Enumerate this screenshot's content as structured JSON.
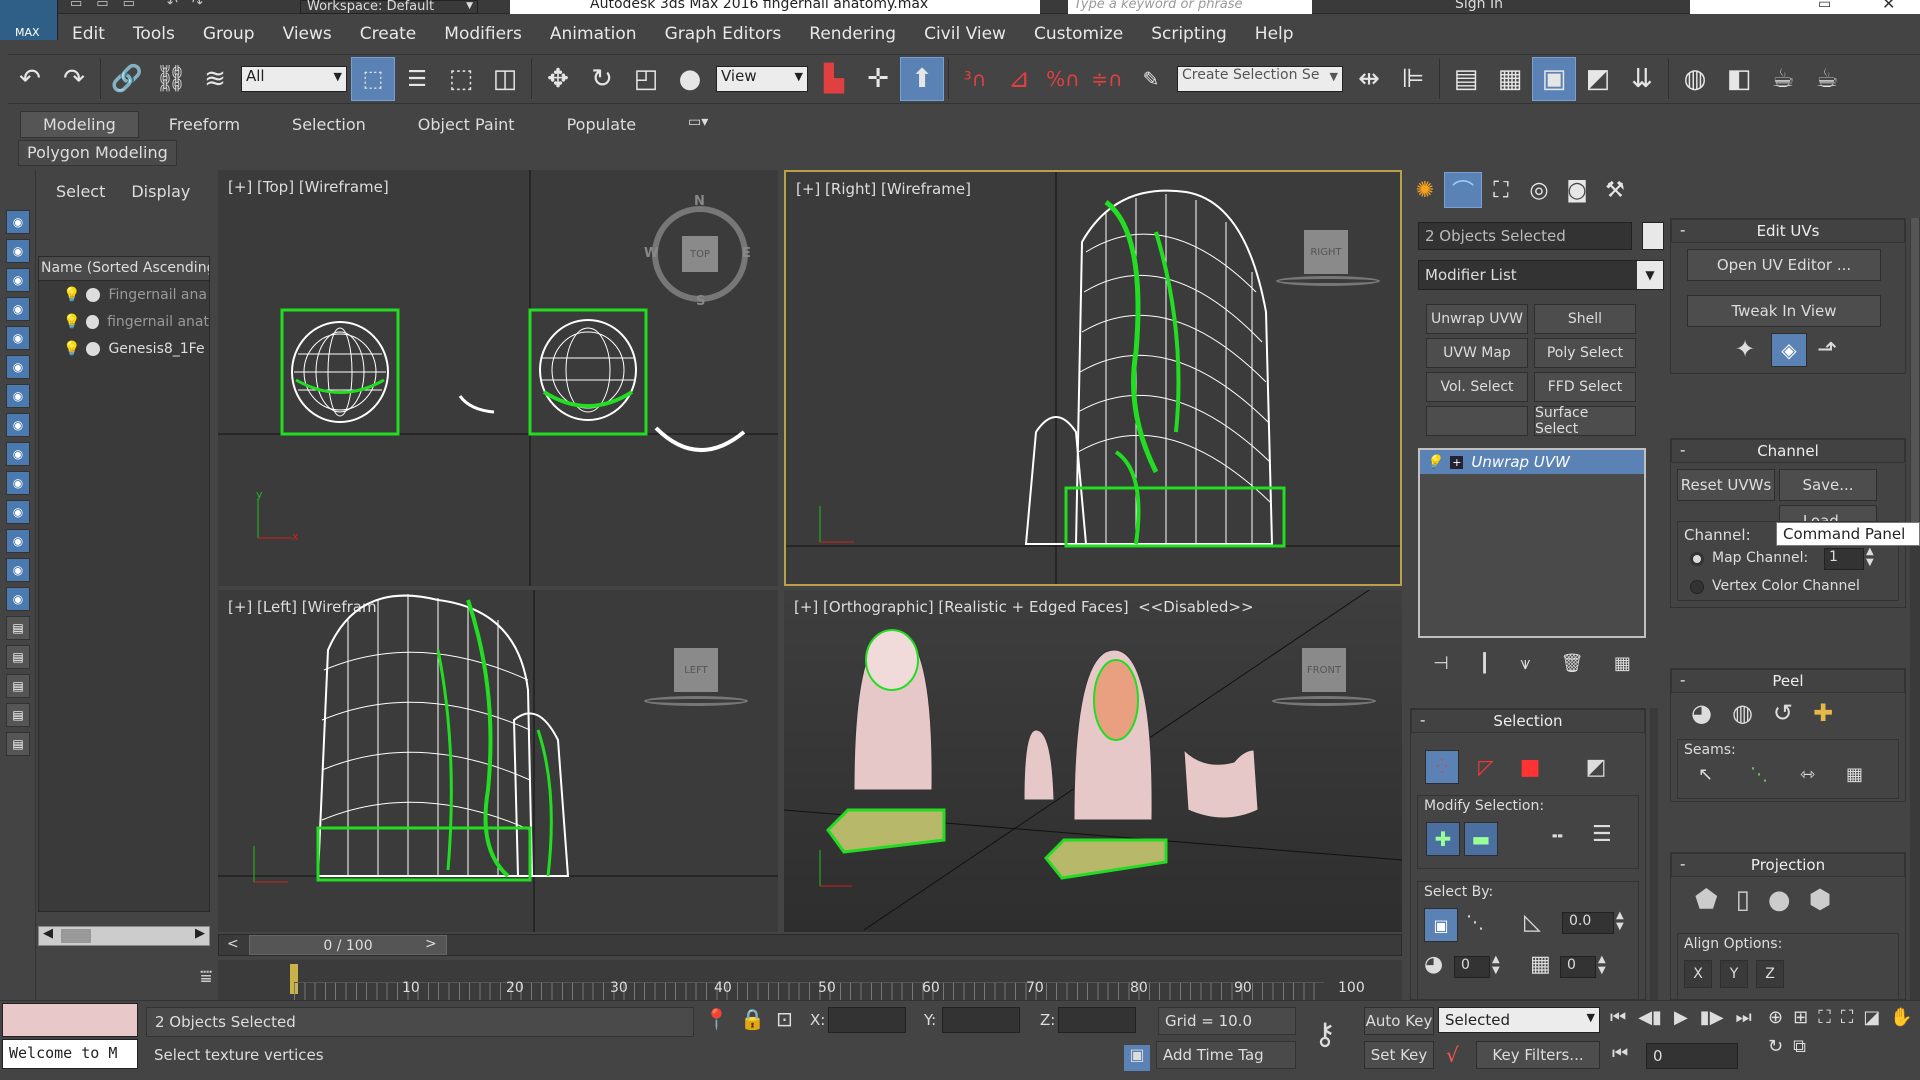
{
  "title_bar": {
    "workspace_label": "Workspace: Default",
    "app_title": "Autodesk 3ds Max 2016    fingernail anatomy.max",
    "search_placeholder": "Type a keyword or phrase",
    "sign_in": "Sign In",
    "logo_text": "MAX"
  },
  "menu": [
    "Edit",
    "Tools",
    "Group",
    "Views",
    "Create",
    "Modifiers",
    "Animation",
    "Graph Editors",
    "Rendering",
    "Civil View",
    "Customize",
    "Scripting",
    "Help"
  ],
  "main_toolbar": {
    "filter_value": "All",
    "ref_coord_value": "View",
    "selection_set_value": "Create Selection Se"
  },
  "ribbon": {
    "tabs": [
      "Modeling",
      "Freeform",
      "Selection",
      "Object Paint",
      "Populate"
    ],
    "active_tab": "Modeling",
    "sub_label": "Polygon Modeling"
  },
  "scene_explorer": {
    "tabs": [
      "Select",
      "Display"
    ],
    "column_header": "Name (Sorted Ascending)",
    "items": [
      "Fingernail ana",
      "fingernail anat",
      "Genesis8_1Fe"
    ]
  },
  "viewports": {
    "top": "[+] [Top] [Wireframe]",
    "right": "[+] [Right] [Wireframe]",
    "left": "[+] [Left] [Wirefram",
    "persp": "[+] [Orthographic] [Realistic + Edged Faces]  <<Disabled>>",
    "cube_top": "TOP",
    "cube_right": "RIGHT",
    "cube_left": "LEFT",
    "cube_front": "FRONT",
    "compass": {
      "n": "N",
      "s": "S",
      "e": "E",
      "w": "W"
    },
    "axis_labels": {
      "x": "x",
      "y": "y",
      "z": "z"
    }
  },
  "timeline": {
    "frame_counter": "0 / 100",
    "ticks": [
      "10",
      "20",
      "30",
      "40",
      "50",
      "60",
      "70",
      "80",
      "90",
      "100"
    ],
    "prev": "<",
    "next": ">"
  },
  "command_panel": {
    "selection_name": "2 Objects Selected",
    "modifier_list": "Modifier List",
    "modifier_buttons": [
      "Unwrap UVW",
      "Shell",
      "UVW Map",
      "Poly Select",
      "Vol. Select",
      "FFD Select",
      "",
      "Surface Select"
    ],
    "stack_item": "Unwrap UVW",
    "selection_rollout": {
      "title": "Selection",
      "modify_selection": "Modify Selection:",
      "select_by": "Select By:",
      "angle_value": "0.0",
      "spin1": "0",
      "spin2": "0"
    }
  },
  "edit_uvs": {
    "title": "Edit UVs",
    "open_uv_editor": "Open UV Editor ...",
    "tweak_in_view": "Tweak In View"
  },
  "channel": {
    "title": "Channel",
    "reset_uvws": "Reset UVWs",
    "save": "Save...",
    "load": "Load...",
    "tooltip": "Command Panel",
    "channel_label": "Channel:",
    "map_channel": "Map Channel:",
    "map_channel_value": "1",
    "vertex_color_channel": "Vertex Color Channel"
  },
  "peel": {
    "title": "Peel",
    "seams": "Seams:"
  },
  "projection": {
    "title": "Projection",
    "align_options": "Align Options:",
    "align_labels": [
      "X",
      "Y",
      "Z"
    ]
  },
  "status_bar": {
    "maxscript": "Welcome to M",
    "selected_count": "2 Objects Selected",
    "prompt": "Select texture vertices",
    "x_label": "X:",
    "y_label": "Y:",
    "z_label": "Z:",
    "grid": "Grid = 10.0",
    "add_time_tag": "Add Time Tag",
    "auto_key": "Auto Key",
    "set_key": "Set Key",
    "key_mode_value": "Selected",
    "key_filters": "Key Filters...",
    "frame_value": "0"
  }
}
